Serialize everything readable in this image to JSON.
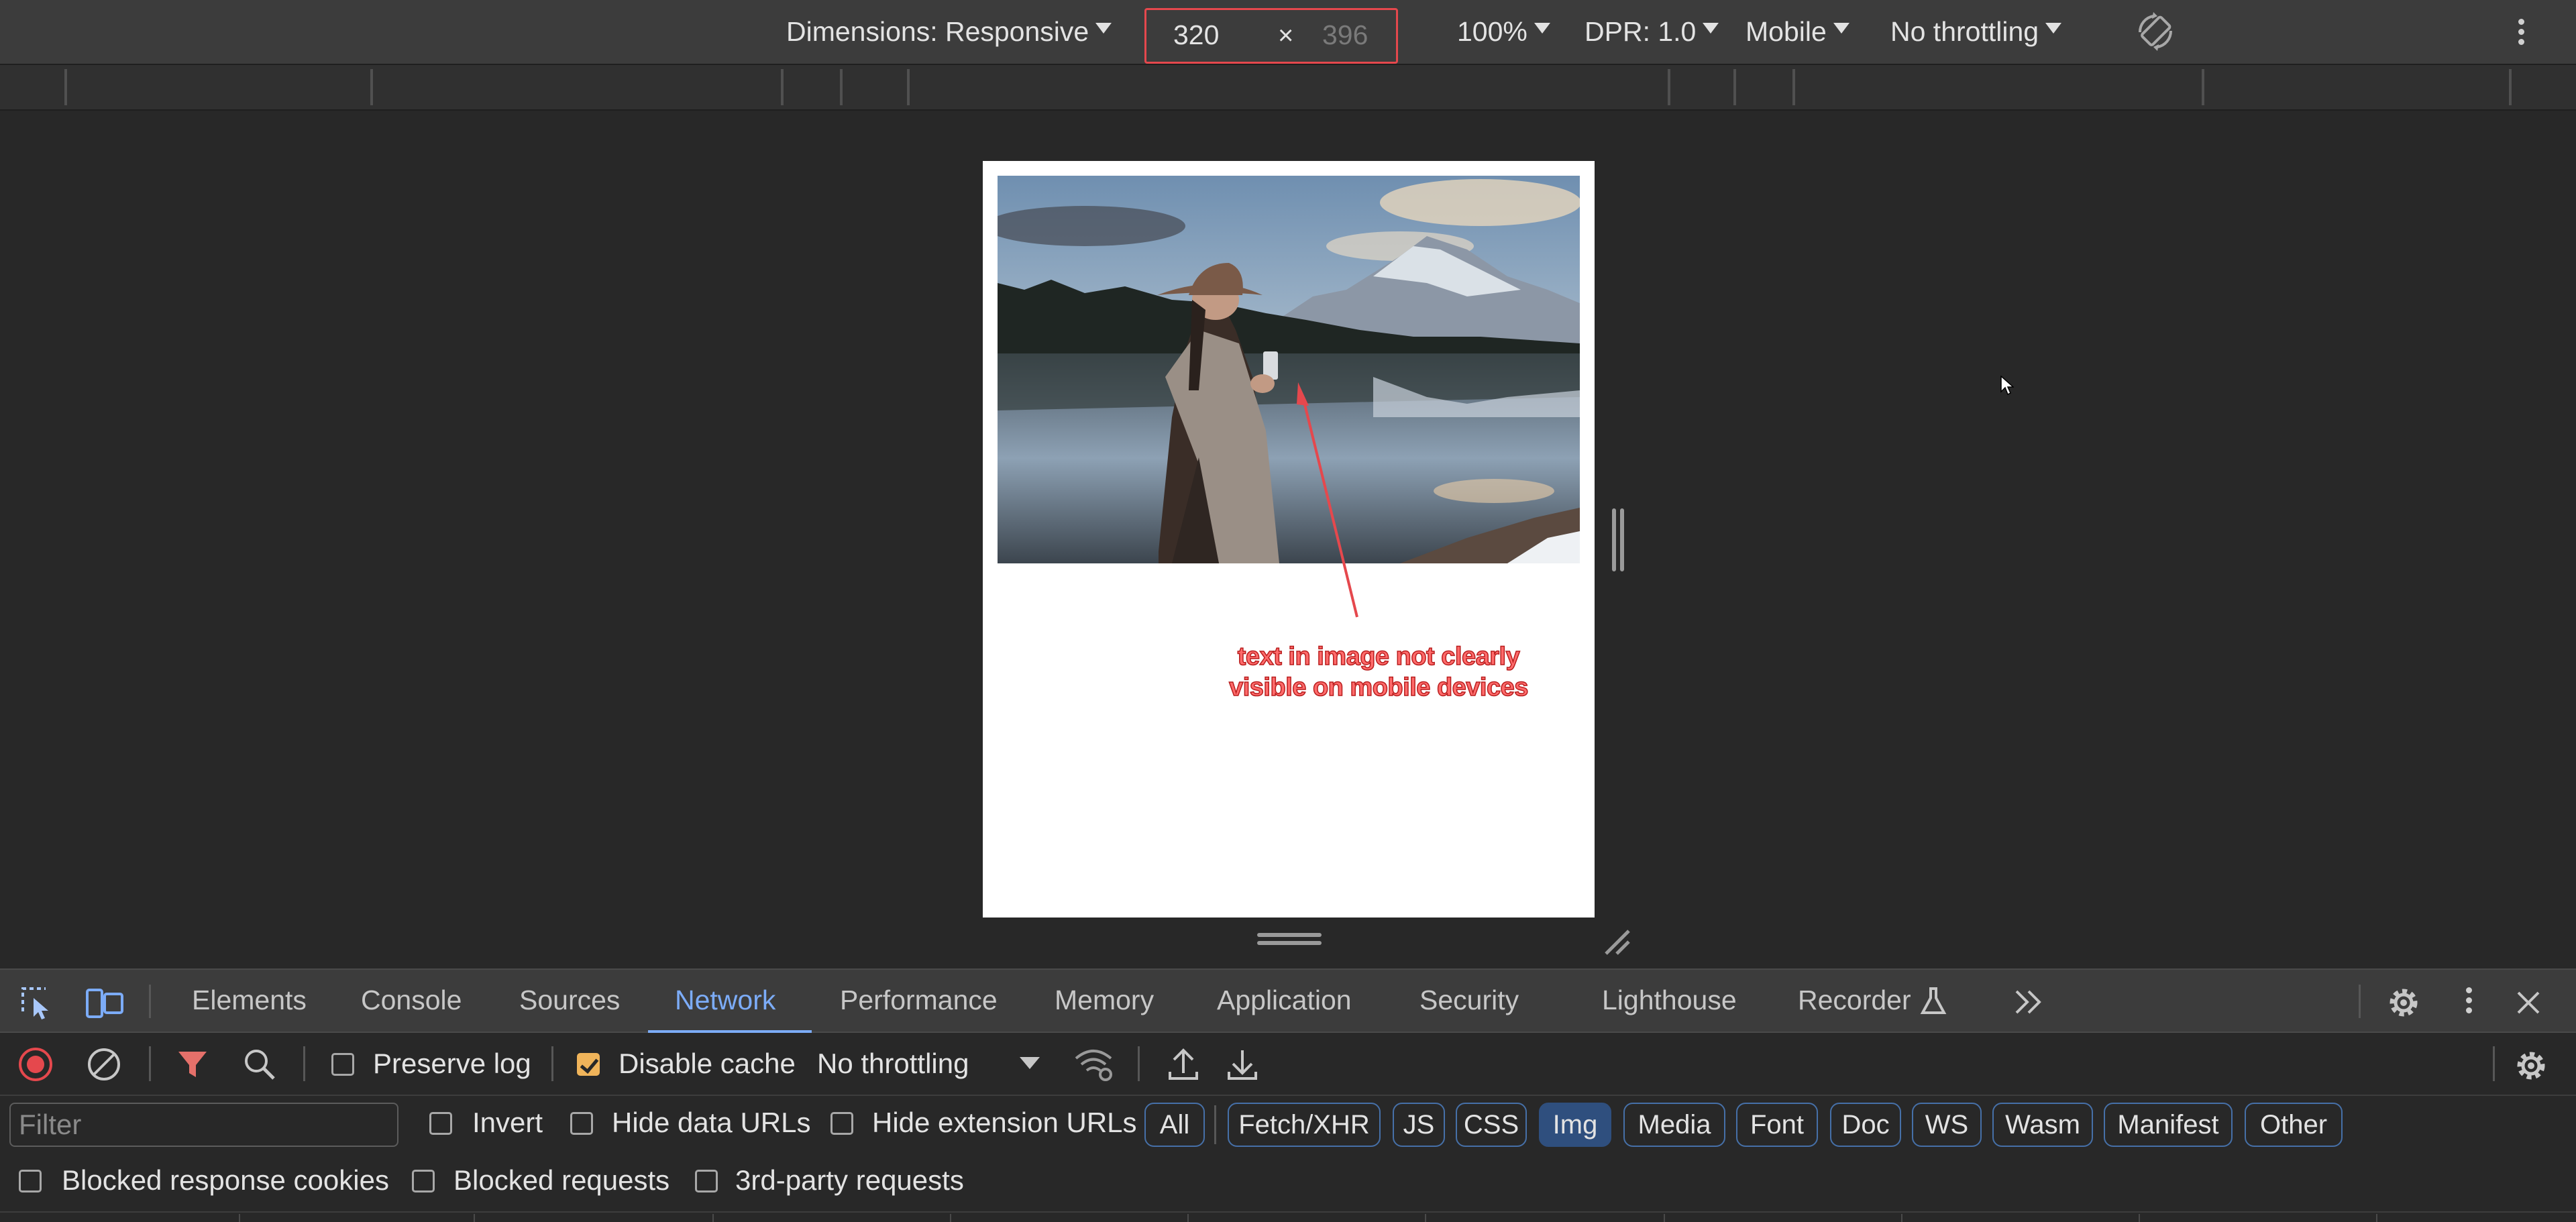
{
  "device_toolbar": {
    "dimensions_label": "Dimensions: Responsive",
    "width_value": "320",
    "times_symbol": "×",
    "height_placeholder": "396",
    "zoom": "100%",
    "dpr": "DPR: 1.0",
    "device_type": "Mobile",
    "throttling": "No throttling",
    "accent_color": "#e5484d"
  },
  "viewport": {
    "annotation_text_line1": "text in image not clearly",
    "annotation_text_line2": "visible on mobile devices"
  },
  "devtools_tabs": {
    "items": [
      "Elements",
      "Console",
      "Sources",
      "Network",
      "Performance",
      "Memory",
      "Application",
      "Security",
      "Lighthouse",
      "Recorder"
    ],
    "active": "Network",
    "more_label": ">>",
    "icons": [
      "inspect-element-icon",
      "device-toolbar-icon",
      "flask-icon",
      "chevron-double-right-icon",
      "gear-icon",
      "kebab-icon",
      "close-icon"
    ]
  },
  "network_toolbar": {
    "preserve_log_label": "Preserve log",
    "preserve_log_checked": false,
    "disable_cache_label": "Disable cache",
    "disable_cache_checked": true,
    "throttling": "No throttling",
    "icons": [
      "record-stop-icon",
      "clear-icon",
      "filter-icon",
      "search-icon",
      "network-conditions-icon",
      "import-har-icon",
      "export-har-icon",
      "gear-icon"
    ]
  },
  "filter_row": {
    "filter_placeholder": "Filter",
    "invert_label": "Invert",
    "hide_data_urls_label": "Hide data URLs",
    "hide_extension_urls_label": "Hide extension URLs",
    "chips": [
      "All",
      "Fetch/XHR",
      "JS",
      "CSS",
      "Img",
      "Media",
      "Font",
      "Doc",
      "WS",
      "Wasm",
      "Manifest",
      "Other"
    ],
    "active_chip": "Img"
  },
  "bottom_row": {
    "blocked_response_cookies_label": "Blocked response cookies",
    "blocked_requests_label": "Blocked requests",
    "third_party_requests_label": "3rd-party requests"
  }
}
